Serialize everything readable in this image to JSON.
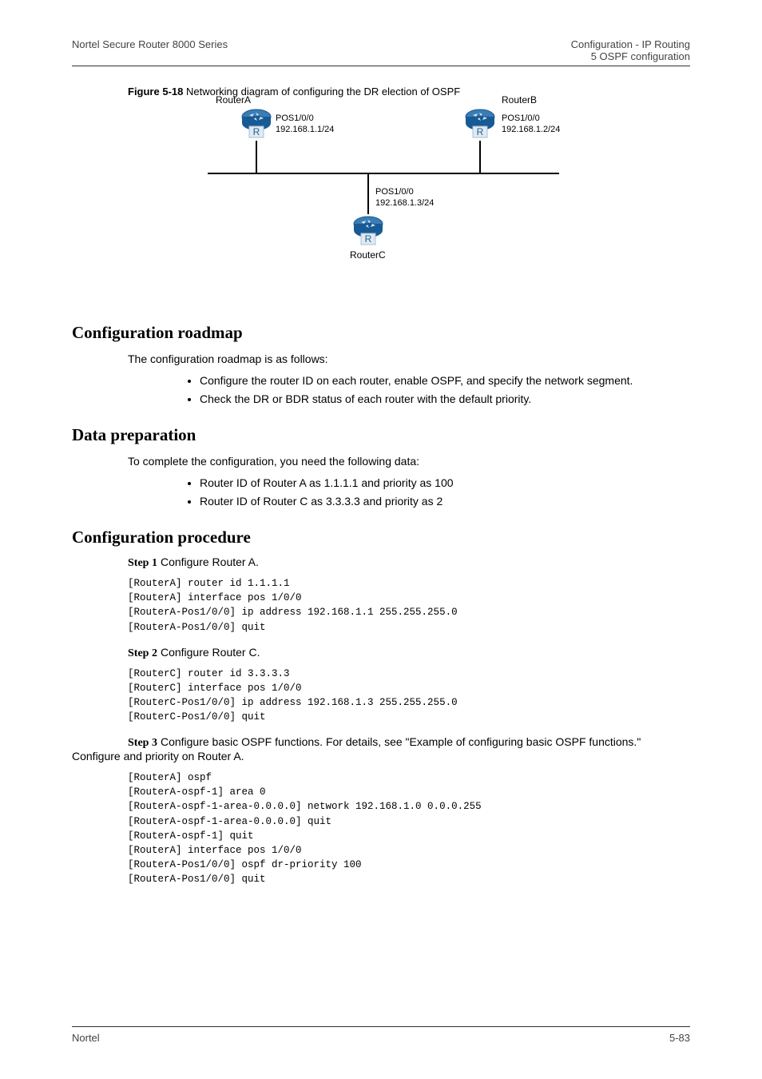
{
  "header": {
    "left": "Nortel Secure Router 8000 Series",
    "right_line1": "Configuration - IP Routing",
    "right_line2": "5 OSPF configuration"
  },
  "figure": {
    "label": "Figure 5-18",
    "caption": "Networking diagram of configuring the DR election of OSPF",
    "routerA": {
      "name": "RouterA",
      "port": "POS1/0/0",
      "ip": "192.168.1.1/24"
    },
    "routerB": {
      "name": "RouterB",
      "port": "POS1/0/0",
      "ip": "192.168.1.2/24"
    },
    "routerC": {
      "name": "RouterC",
      "port": "POS1/0/0",
      "ip": "192.168.1.3/24"
    }
  },
  "roadmap": {
    "heading": "Configuration roadmap",
    "intro": "The configuration roadmap is as follows:",
    "items": [
      "Configure the router ID on each router, enable OSPF, and specify the network segment.",
      "Check the DR or BDR status of each router with the default priority."
    ]
  },
  "dataprep": {
    "heading": "Data preparation",
    "intro": "To complete the configuration, you need the following data:",
    "items": [
      "Router ID of Router A as 1.1.1.1 and priority as 100",
      "Router ID of Router C as 3.3.3.3 and priority as 2"
    ]
  },
  "procedure": {
    "heading": "Configuration procedure",
    "step1": {
      "label": "Step 1",
      "text": "Configure Router A.",
      "cli": "[RouterA] router id 1.1.1.1\n[RouterA] interface pos 1/0/0\n[RouterA-Pos1/0/0] ip address 192.168.1.1 255.255.255.0\n[RouterA-Pos1/0/0] quit"
    },
    "step2": {
      "label": "Step 2",
      "text": "Configure Router C.",
      "cli": "[RouterC] router id 3.3.3.3\n[RouterC] interface pos 1/0/0\n[RouterC-Pos1/0/0] ip address 192.168.1.3 255.255.255.0\n[RouterC-Pos1/0/0] quit"
    },
    "step3": {
      "label": "Step 3",
      "text": "Configure basic OSPF functions. For details, see \"Example of configuring basic OSPF functions.\" Configure and priority on Router A.",
      "cli": "[RouterA] ospf\n[RouterA-ospf-1] area 0\n[RouterA-ospf-1-area-0.0.0.0] network 192.168.1.0 0.0.0.255\n[RouterA-ospf-1-area-0.0.0.0] quit\n[RouterA-ospf-1] quit\n[RouterA] interface pos 1/0/0\n[RouterA-Pos1/0/0] ospf dr-priority 100\n[RouterA-Pos1/0/0] quit"
    }
  },
  "footer": {
    "left": "Nortel",
    "right": "5-83"
  }
}
